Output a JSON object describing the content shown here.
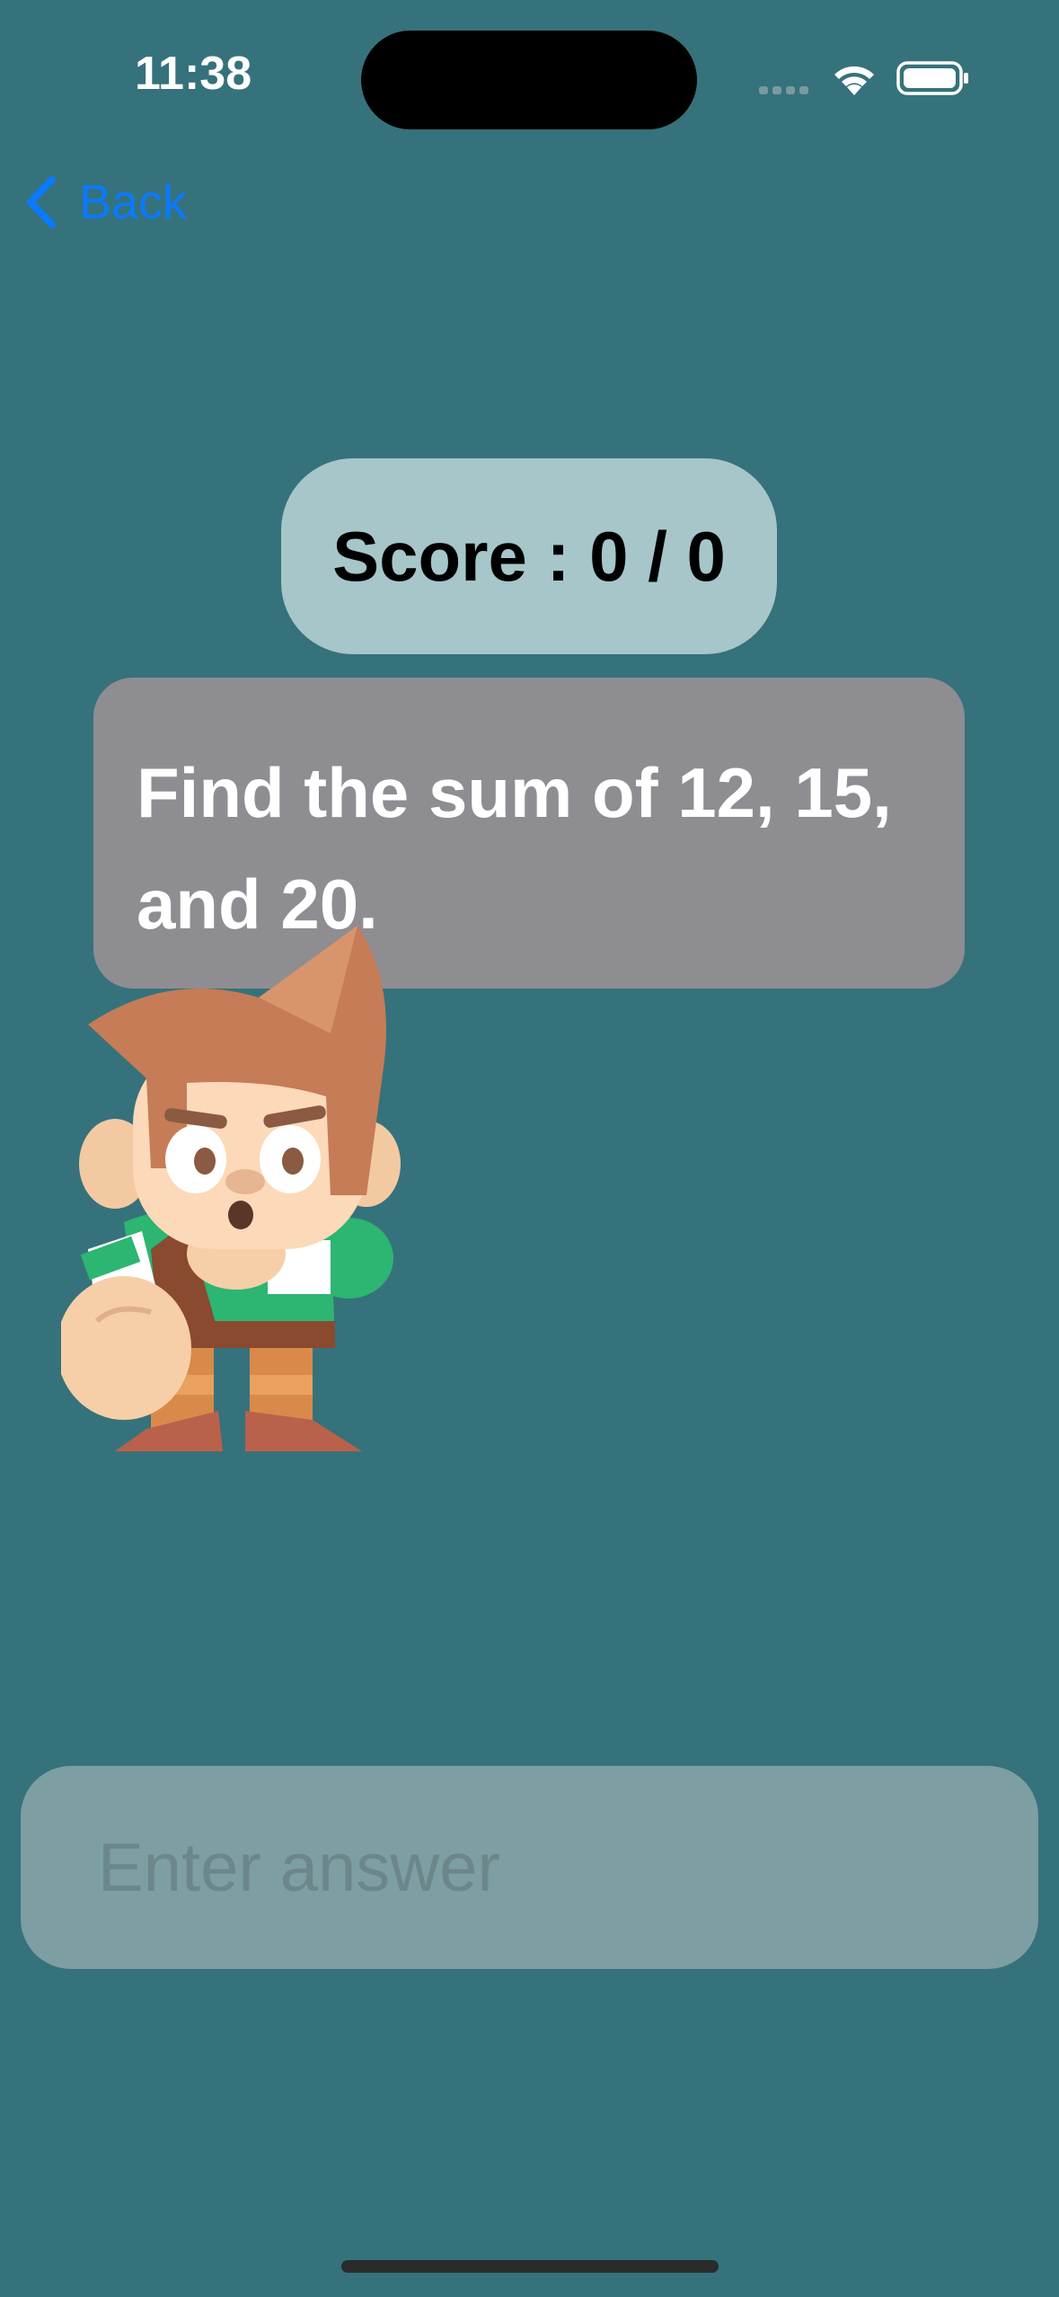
{
  "status_bar": {
    "time": "11:38"
  },
  "nav": {
    "back_label": "Back"
  },
  "score": {
    "text": "Score : 0 / 0"
  },
  "question": {
    "text": "Find the sum of 12, 15, and 20."
  },
  "answer": {
    "placeholder": "Enter answer",
    "value": ""
  },
  "colors": {
    "background": "#36727b",
    "accent": "#0a7aff",
    "score_bg": "#a6c6ca",
    "card_bg": "#8e8d92",
    "input_bg": "#7d9ea3"
  },
  "icons": {
    "back": "chevron-left-icon",
    "wifi": "wifi-icon",
    "battery": "battery-icon",
    "signal": "signal-icon"
  }
}
